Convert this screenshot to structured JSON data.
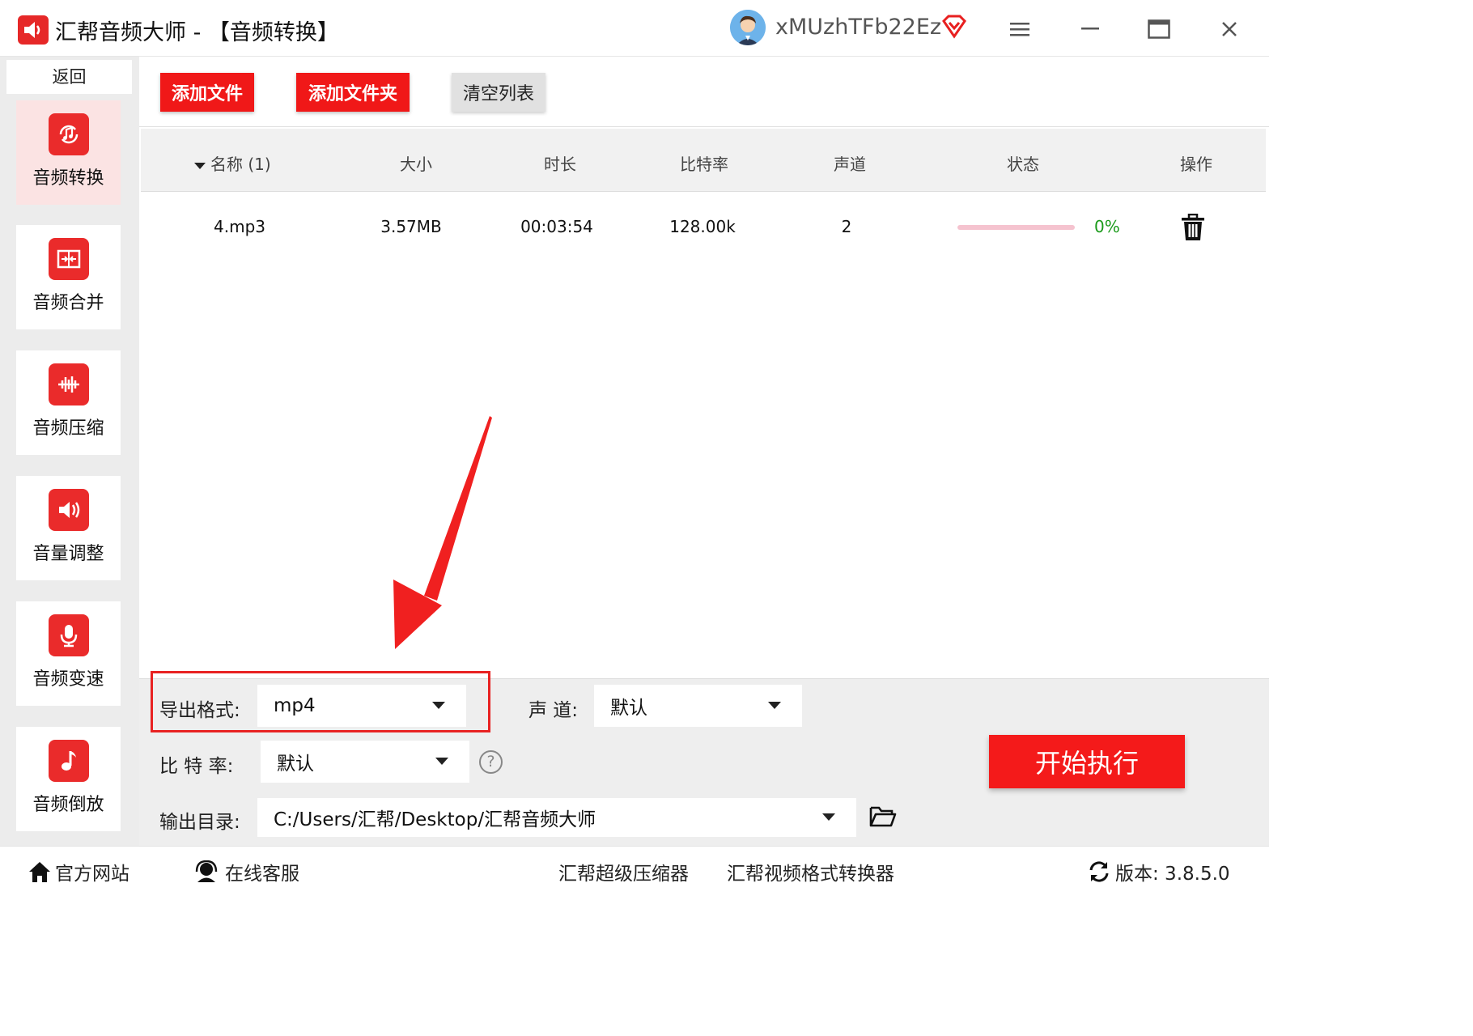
{
  "window": {
    "app_name": "汇帮音频大师",
    "title_suffix": " - 【音频转换】",
    "username": "xMUzhTFb22Ez"
  },
  "sidebar": {
    "back_label": "返回",
    "items": [
      {
        "label": "音频转换",
        "icon": "audio-convert-icon",
        "active": true
      },
      {
        "label": "音频合并",
        "icon": "audio-merge-icon"
      },
      {
        "label": "音频压缩",
        "icon": "audio-compress-icon"
      },
      {
        "label": "音量调整",
        "icon": "volume-icon"
      },
      {
        "label": "音频变速",
        "icon": "microphone-icon"
      },
      {
        "label": "音频倒放",
        "icon": "music-note-icon"
      }
    ]
  },
  "toolbar": {
    "add_file": "添加文件",
    "add_folder": "添加文件夹",
    "clear_list": "清空列表"
  },
  "table": {
    "columns": {
      "name": "名称 (1)",
      "size": "大小",
      "duration": "时长",
      "bitrate": "比特率",
      "channels": "声道",
      "status": "状态",
      "action": "操作"
    },
    "rows": [
      {
        "name": "4.mp3",
        "size": "3.57MB",
        "duration": "00:03:54",
        "bitrate": "128.00k",
        "channels": "2",
        "progress": 0,
        "percent": "0%"
      }
    ]
  },
  "settings": {
    "format_label": "导出格式:",
    "format_value": "mp4",
    "channel_label": "声  道:",
    "channel_value": "默认",
    "bitrate_label": "比 特 率:",
    "bitrate_value": "默认",
    "help": "?",
    "output_label": "输出目录:",
    "output_value": "C:/Users/汇帮/Desktop/汇帮音频大师"
  },
  "start_button": "开始执行",
  "footer": {
    "website": "官方网站",
    "support": "在线客服",
    "compressor": "汇帮超级压缩器",
    "video_converter": "汇帮视频格式转换器",
    "version": "版本: 3.8.5.0"
  },
  "colors": {
    "accent_red": "#f01818",
    "progress_track": "#f5c3cf",
    "percent_green": "#1a9a1a"
  }
}
